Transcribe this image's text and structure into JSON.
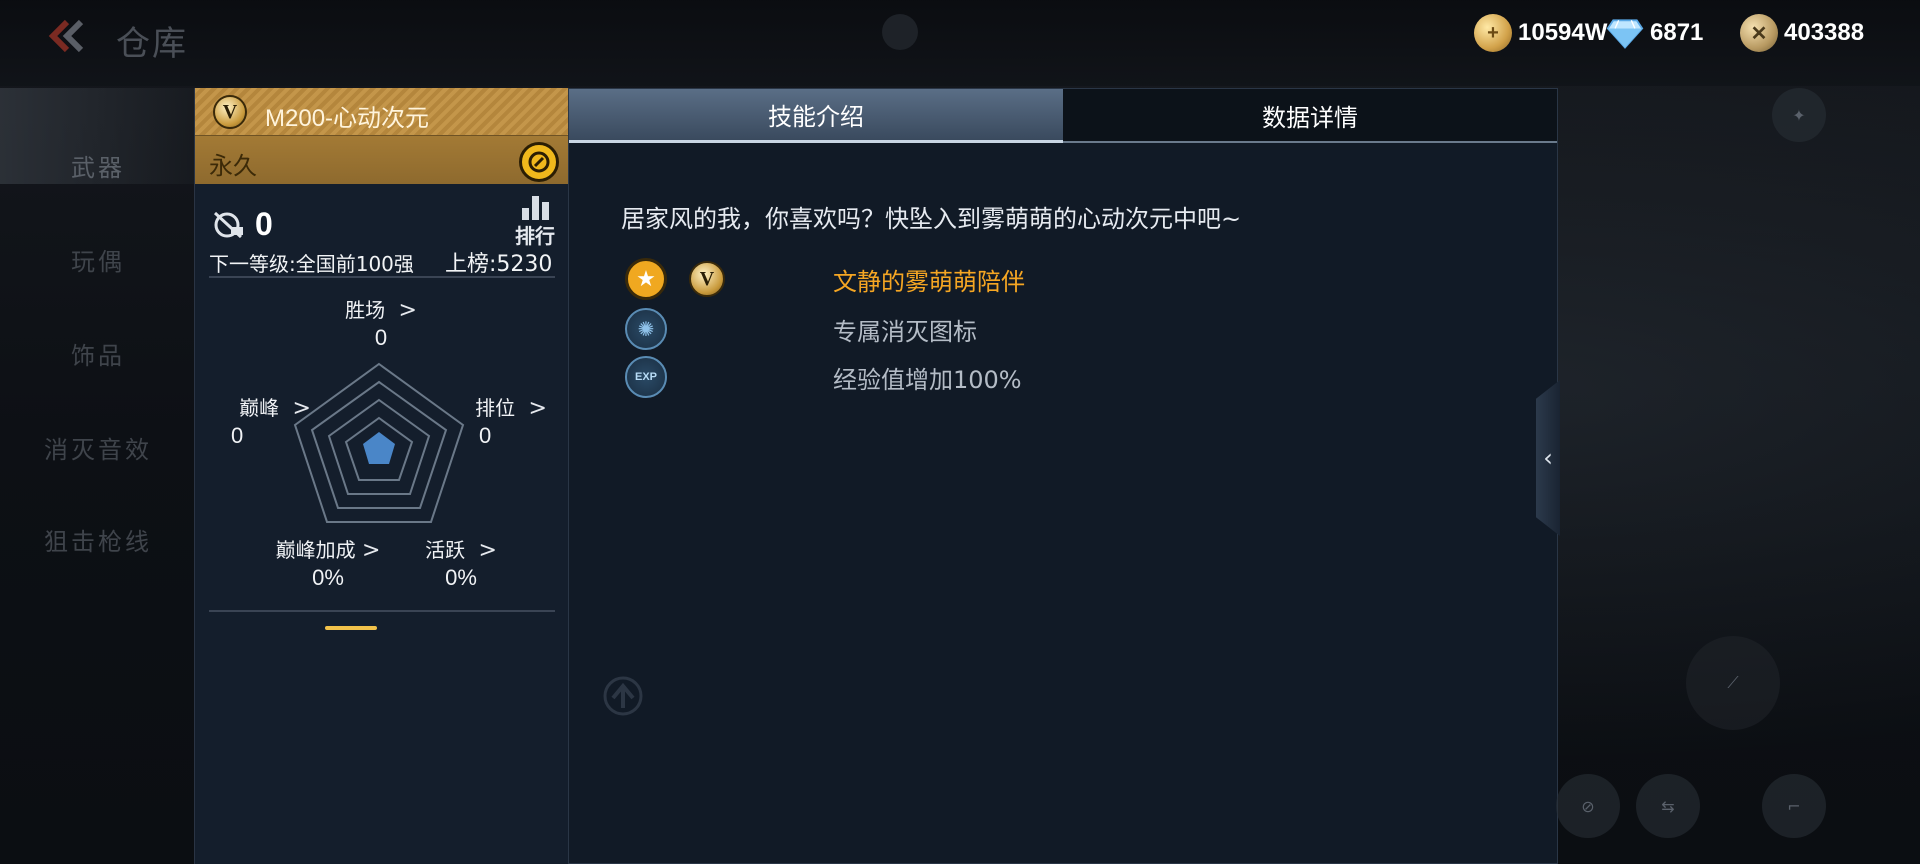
{
  "header": {
    "title": "仓库",
    "currencies": [
      {
        "icon": "gold-coin-icon",
        "value": "10594W"
      },
      {
        "icon": "diamond-icon",
        "value": "6871"
      },
      {
        "icon": "medal-icon",
        "value": "403388"
      }
    ]
  },
  "sidenav": {
    "items": [
      {
        "label": "武器"
      },
      {
        "label": "玩偶"
      },
      {
        "label": "饰品"
      },
      {
        "label": "消灭音效"
      },
      {
        "label": "狙击枪线"
      }
    ]
  },
  "weapon_card": {
    "name": "M200-心动次元",
    "duration": "永久",
    "kills": "0",
    "rank_label": "排行",
    "next_level": "下一等级:全国前100强",
    "board": "上榜:5230",
    "stats": {
      "wins": {
        "label": "胜场",
        "value": "0"
      },
      "peak": {
        "label": "巅峰",
        "value": "0"
      },
      "ranked": {
        "label": "排位",
        "value": "0"
      },
      "peak_bonus": {
        "label": "巅峰加成",
        "value": "0%"
      },
      "active": {
        "label": "活跃",
        "value": "0%"
      }
    }
  },
  "panel": {
    "tabs": [
      {
        "label": "技能介绍",
        "active": true
      },
      {
        "label": "数据详情",
        "active": false
      }
    ],
    "description": "居家风的我，你喜欢吗？快坠入到雾萌萌的心动次元中吧~",
    "skills": [
      {
        "icon": "star-icon",
        "text": "文静的雾萌萌陪伴",
        "color": "#f5a623"
      },
      {
        "icon": "elimination-icon",
        "text": "专属消灭图标",
        "color": "#b4bcc6"
      },
      {
        "icon": "exp-icon",
        "text": "经验值增加100%",
        "color": "#b4bcc6"
      }
    ]
  },
  "colors": {
    "accent_gold": "#c4964a",
    "highlight_orange": "#f5a623",
    "panel_bg": "#111a26"
  }
}
